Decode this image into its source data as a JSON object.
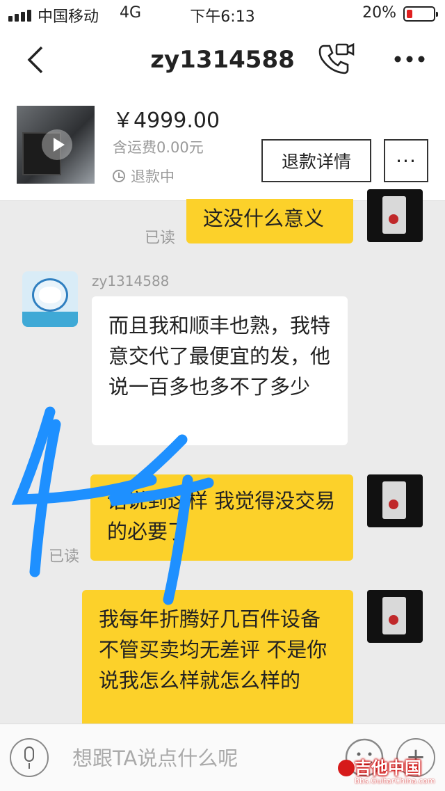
{
  "status_bar": {
    "carrier": "中国移动",
    "network": "4G",
    "time": "下午6:13",
    "battery": "20%",
    "battery_level": 0.2
  },
  "nav": {
    "title": "zy1314588",
    "back_icon": "chevron-left-icon",
    "call_icon": "phone-video-icon",
    "more_icon": "more-horizontal-icon"
  },
  "product": {
    "price": "￥4999.00",
    "shipping": "含运费0.00元",
    "status": "退款中",
    "refund_button": "退款详情",
    "more_button": "···"
  },
  "messages": [
    {
      "side": "right",
      "text": "这没什么意义",
      "read": "已读"
    },
    {
      "side": "left",
      "sender": "zy1314588",
      "text": "而且我和顺丰也熟，我特意交代了最便宜的发，他说一百多也多不了多少"
    },
    {
      "side": "right",
      "text": "话说到这样 我觉得没交易的必要了",
      "read": "已读"
    },
    {
      "side": "right",
      "text": "我每年折腾好几百件设备 不管买卖均无差评 不是你说我怎么样就怎么样的"
    }
  ],
  "input": {
    "placeholder": "想跟TA说点什么呢"
  },
  "watermark": {
    "title": "吉他中国",
    "url": "bbs.GuitarChina.com"
  },
  "colors": {
    "my_bubble": "#fcd12a",
    "their_bubble": "#ffffff",
    "annotation": "#1e90ff"
  }
}
